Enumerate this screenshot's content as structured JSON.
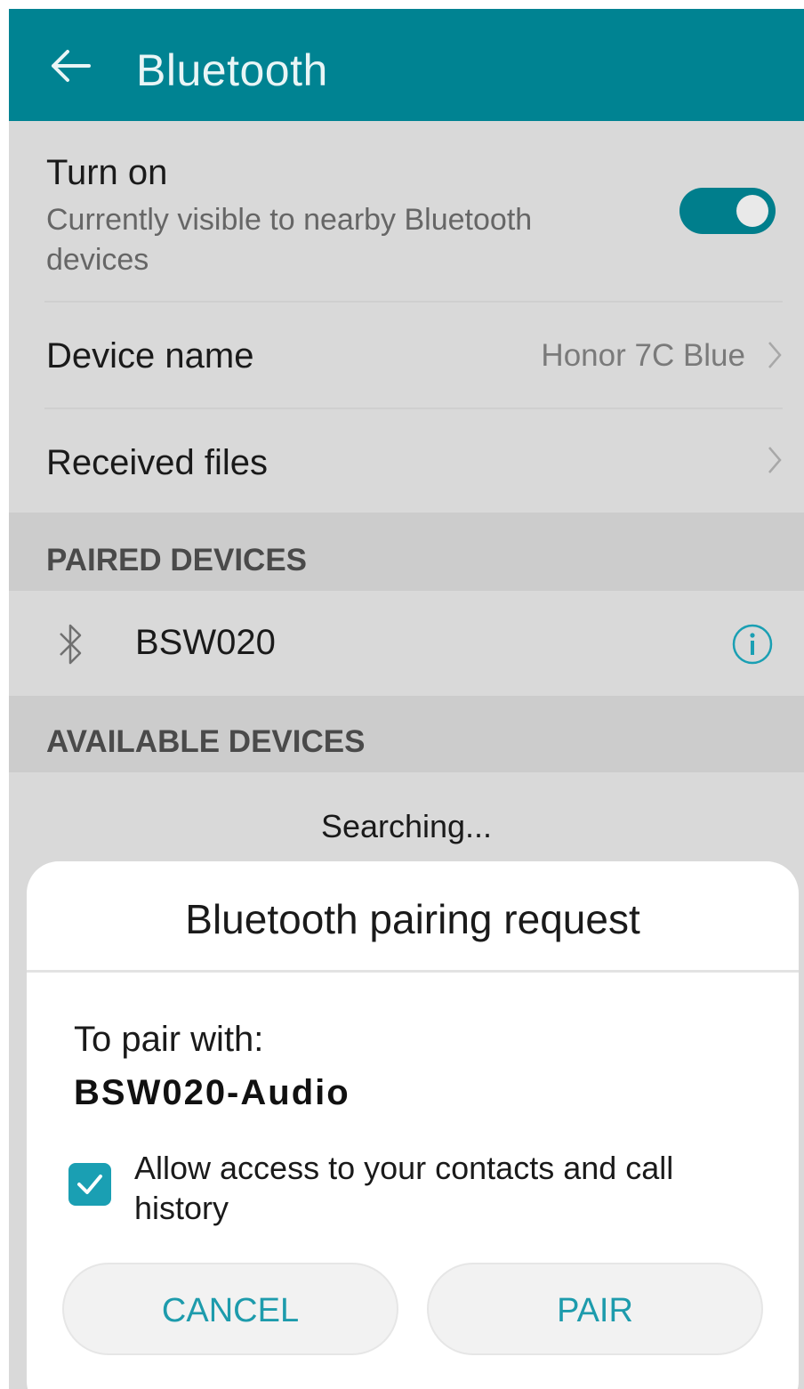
{
  "appbar": {
    "title": "Bluetooth"
  },
  "turn_on": {
    "label": "Turn on",
    "description_line1": "Currently visible to nearby Bluetooth",
    "description_line2": "devices",
    "enabled": true
  },
  "device_name": {
    "label": "Device name",
    "value": "Honor 7C Blue"
  },
  "received_files": {
    "label": "Received files"
  },
  "paired_devices": {
    "header": "PAIRED DEVICES",
    "items": [
      {
        "name": "BSW020"
      }
    ]
  },
  "available_devices": {
    "header": "AVAILABLE DEVICES",
    "status": "Searching..."
  },
  "dialog": {
    "title": "Bluetooth pairing request",
    "pair_with_label": "To pair with:",
    "device": "BSW020-Audio",
    "allow_access_line1": "Allow access to your contacts and call",
    "allow_access_line2": "history",
    "allow_access_checked": true,
    "cancel_label": "CANCEL",
    "pair_label": "PAIR"
  },
  "colors": {
    "accent": "#008392",
    "button_text": "#1d9bac"
  }
}
